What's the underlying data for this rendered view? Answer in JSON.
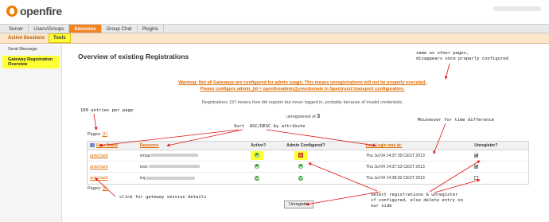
{
  "app": {
    "logo_text": "openfire"
  },
  "nav": {
    "tabs": [
      "Server",
      "Users/Groups",
      "Sessions",
      "Group Chat",
      "Plugins"
    ],
    "active": "Sessions"
  },
  "subnav": {
    "tabs": [
      "Active Sessions",
      "Tools"
    ],
    "active": "Tools"
  },
  "sidebar": {
    "items": [
      "Send Message",
      "Gateway Registration Overview"
    ],
    "active": "Gateway Registration Overview"
  },
  "page": {
    "title": "Overview of existing Registrations",
    "warning_line1": "Warning: Not all Gateways are configured for admin usage. This means unregistrations will not be properly executed.",
    "warning_line2": "Please configure admin_jid = openfireadmin@yourdomain in Spectrum2 transport configuration.",
    "info": "Registrations 197 means how did register but never logged in, probably because of invalid credentials.",
    "counter_prefix": "unregistered of",
    "counter_value": "3",
    "pages_label": "Pages:",
    "pages_value": "[1]",
    "unregister_button": "Unregister"
  },
  "table": {
    "headers": {
      "user": "User Name",
      "resource": "Resource",
      "active": "Active?",
      "admin": "Admin Configured?",
      "last_login": "Last Login was at:",
      "unregister": "Unregister?"
    },
    "rows": [
      {
        "user": "anwi.hard",
        "resource": "xmpp",
        "last_login": "Thu Jul 04 14:37:39 CEST 2013",
        "unregister": true
      },
      {
        "user": "anwi.hard",
        "resource": "msn",
        "last_login": "Thu Jul 04 14:37:53 CEST 2013",
        "unregister": true
      },
      {
        "user": "anwi.hard",
        "resource": "icq",
        "last_login": "Thu Jul 04 14:38:02 CEST 2013",
        "unregister": false
      }
    ]
  },
  "annotations": {
    "same_as_other": "same as other pages,\ndisappears once properly configured",
    "entries": "100 entries per page",
    "sort": "Sort  ASC/DESC by attribute",
    "mouseover": "Mouseover for time difference",
    "click_gateway": "click for gateway session details",
    "select_unreg": "Select registrations & unregister\nif configured, else delete entry on\nour side"
  }
}
